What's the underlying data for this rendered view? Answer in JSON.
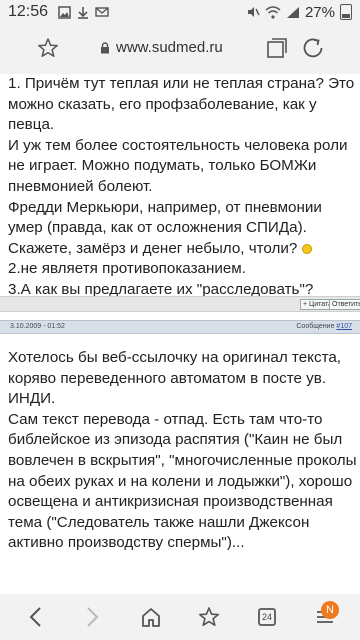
{
  "status_bar": {
    "time": "12:56",
    "battery": "27%"
  },
  "browser": {
    "url": "www.sudmed.ru",
    "tabs_count": "24",
    "menu_badge": "N"
  },
  "post1": {
    "lines": [
      "1. Причём тут теплая или не теплая страна? Это можно сказать, его профзаболевание, как у певца.",
      "И уж тем более состоятельность человека роли не играет. Можно подумать, только БОМЖи пневмонией болеют.",
      "Фредди Меркьюри, например, от пневмонии умер (правда, как от осложнения СПИДа). Скажете, замёрз и денег небыло, чтоли?",
      "2.не являетя противопоказанием.",
      "3.А как вы предлагаете их \"расследовать\"?"
    ],
    "actions": {
      "quote": "+ Цитата",
      "reply": "Ответить"
    }
  },
  "post2_header": {
    "date": "3.10.2009 - 01:52",
    "message_label": "Сообщение",
    "message_number": "#107"
  },
  "post2": {
    "lines": [
      "Хотелось бы веб-ссылочку на оригинал текста, коряво переведенного автоматом в посте ув. ИНДИ.",
      "Сам текст перевода - отпад. Есть там что-то библейское из эпизода распятия (\"Каин не был вовлечен в вскрытия\", \"многочисленные проколы на обеих руках и на колени и лодыжки\"), хорошо освещена и антикризисная производственная тема (\"Следователь также нашли Джексон активно производству спермы\")..."
    ]
  }
}
